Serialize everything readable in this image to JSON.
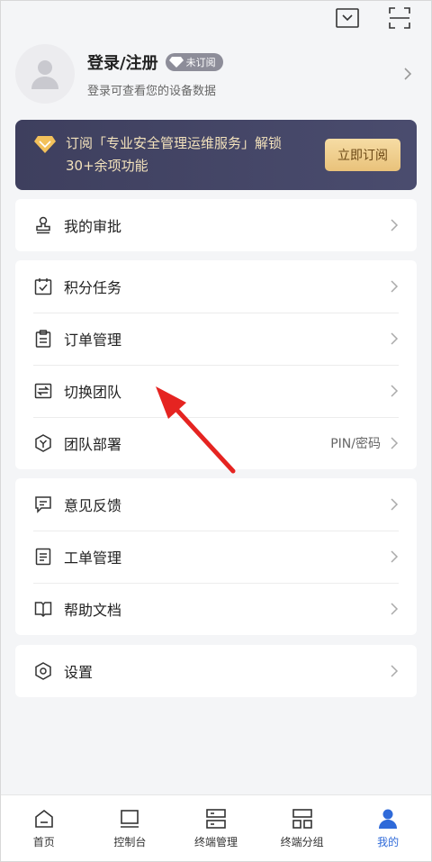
{
  "profile": {
    "name": "登录/注册",
    "badge": "未订阅",
    "subtitle": "登录可查看您的设备数据"
  },
  "banner": {
    "line1": "订阅「专业安全管理运维服务」解锁",
    "line2": "30+余项功能",
    "button": "立即订阅"
  },
  "menu": {
    "group1": [
      {
        "label": "我的审批",
        "icon": "approval-stamp-icon"
      }
    ],
    "group2": [
      {
        "label": "积分任务",
        "icon": "calendar-check-icon"
      },
      {
        "label": "订单管理",
        "icon": "clipboard-icon"
      },
      {
        "label": "切换团队",
        "icon": "switch-team-icon"
      },
      {
        "label": "团队部署",
        "icon": "hexagon-deploy-icon",
        "extra": "PIN/密码"
      }
    ],
    "group3": [
      {
        "label": "意见反馈",
        "icon": "feedback-chat-icon"
      },
      {
        "label": "工单管理",
        "icon": "work-order-icon"
      },
      {
        "label": "帮助文档",
        "icon": "book-icon"
      }
    ],
    "group4": [
      {
        "label": "设置",
        "icon": "settings-hexagon-icon"
      }
    ]
  },
  "tabs": [
    {
      "label": "首页",
      "icon": "home-icon",
      "active": false
    },
    {
      "label": "控制台",
      "icon": "monitor-icon",
      "active": false
    },
    {
      "label": "终端管理",
      "icon": "server-icon",
      "active": false
    },
    {
      "label": "终端分组",
      "icon": "grid-group-icon",
      "active": false
    },
    {
      "label": "我的",
      "icon": "user-icon",
      "active": true
    }
  ],
  "colors": {
    "accent": "#2f6ad9",
    "banner_bg": "#3e3f5e",
    "banner_text": "#f3e2bc",
    "annotation_arrow": "#e52421"
  }
}
